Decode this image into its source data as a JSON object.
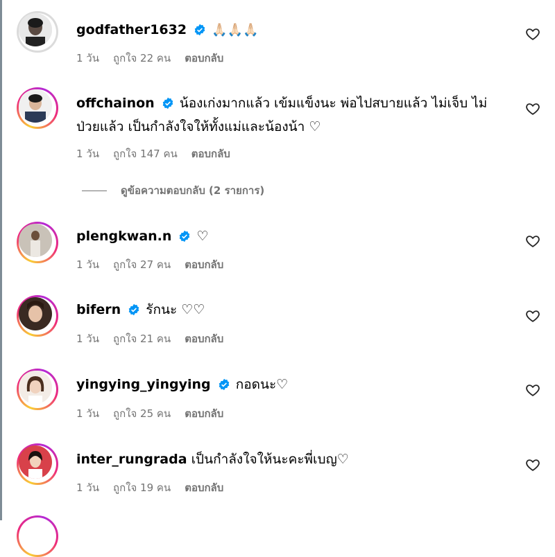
{
  "comments": [
    {
      "username": "godfather1632",
      "verified": true,
      "text": "🙏🏻🙏🏻🙏🏻",
      "time": "1 วัน",
      "likes": "ถูกใจ 22 คน",
      "reply": "ตอบกลับ",
      "ring": "none"
    },
    {
      "username": "offchainon",
      "verified": true,
      "text": "น้องเก่งมากแล้ว เข้มแข็งนะ พ่อไปสบายแล้ว ไม่เจ็บ ไม่ป่วยแล้ว เป็นกำลังใจให้ทั้งแม่และน้องน้า ♡",
      "time": "1 วัน",
      "likes": "ถูกใจ 147 คน",
      "reply": "ตอบกลับ",
      "ring": "gradient"
    },
    {
      "username": "plengkwan.n",
      "verified": true,
      "text": "♡",
      "time": "1 วัน",
      "likes": "ถูกใจ 27 คน",
      "reply": "ตอบกลับ",
      "ring": "gradient"
    },
    {
      "username": "bifern",
      "verified": true,
      "text": "รักนะ ♡♡",
      "time": "1 วัน",
      "likes": "ถูกใจ 21 คน",
      "reply": "ตอบกลับ",
      "ring": "gradient"
    },
    {
      "username": "yingying_yingying",
      "verified": true,
      "text": "กอดนะ♡",
      "time": "1 วัน",
      "likes": "ถูกใจ 25 คน",
      "reply": "ตอบกลับ",
      "ring": "gradient"
    },
    {
      "username": "inter_rungrada",
      "verified": false,
      "text": "เป็นกำลังใจให้นะคะพี่เบญ♡",
      "time": "1 วัน",
      "likes": "ถูกใจ 19 คน",
      "reply": "ตอบกลับ",
      "ring": "gradient"
    }
  ],
  "view_replies": "ดูข้อความตอบกลับ (2 รายการ)",
  "colors": {
    "verified_badge": "#0095f6",
    "meta_text": "#737373",
    "ring_gradient": [
      "#f9ce34",
      "#ee2a7b",
      "#b42ad6"
    ]
  },
  "icons": {
    "verified": "verified-badge-icon",
    "like": "heart-outline-icon"
  }
}
